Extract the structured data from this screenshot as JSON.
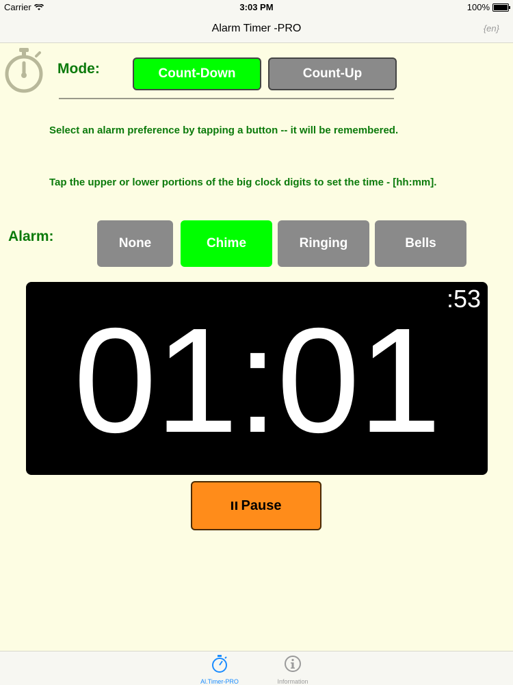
{
  "status_bar": {
    "carrier": "Carrier",
    "time": "3:03 PM",
    "battery": "100%"
  },
  "nav": {
    "title": "Alarm Timer -PRO",
    "lang": "{en}"
  },
  "mode": {
    "label": "Mode:",
    "count_down": "Count-Down",
    "count_up": "Count-Up",
    "selected": "count_down"
  },
  "instructions": {
    "line1": "Select an alarm preference by tapping a button -- it will be remembered.",
    "line2": "Tap the upper or lower portions of the big clock digits to set the time - [hh:mm]."
  },
  "alarm": {
    "label": "Alarm:",
    "options": [
      "None",
      "Chime",
      "Ringing",
      "Bells"
    ],
    "selected": "Chime"
  },
  "clock": {
    "time": "01:01",
    "seconds": ":53"
  },
  "pause": {
    "label": "Pause"
  },
  "tabs": [
    {
      "label": "Al.Timer-PRO",
      "icon": "stopwatch-icon",
      "active": true
    },
    {
      "label": "Information",
      "icon": "info-icon",
      "active": false
    }
  ],
  "colors": {
    "background": "#fdfde3",
    "selected": "#00ff00",
    "unselected": "#8a8a8a",
    "accent_text": "#0b7a0b",
    "pause": "#ff8c1a",
    "tab_active": "#1a8cff"
  }
}
